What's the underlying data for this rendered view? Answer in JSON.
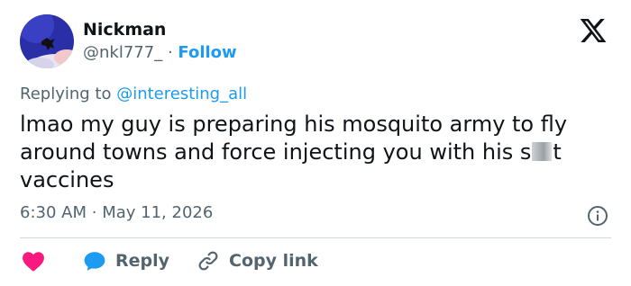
{
  "author": {
    "name": "Nickman",
    "handle": "@nkl777_",
    "separator": "·",
    "follow_label": "Follow"
  },
  "reply_context": {
    "prefix": "Replying to",
    "mention": "@interesting_all"
  },
  "tweet": {
    "text_before": "lmao my guy is preparing his mosquito army to fly around towns and force injecting you with his s",
    "text_after": "t vaccines"
  },
  "meta": {
    "time": "6:30 AM",
    "separator": "·",
    "date": "May 11, 2026"
  },
  "actions": {
    "reply_label": "Reply",
    "copy_label": "Copy link"
  },
  "icons": {
    "logo": "x-logo-icon",
    "info": "info-icon",
    "like": "heart-icon",
    "reply": "speech-bubble-icon",
    "copy": "link-icon"
  },
  "colors": {
    "accent": "#1d9bf0",
    "heart": "#f91880",
    "text": "#0f1419",
    "secondary": "#536471"
  }
}
